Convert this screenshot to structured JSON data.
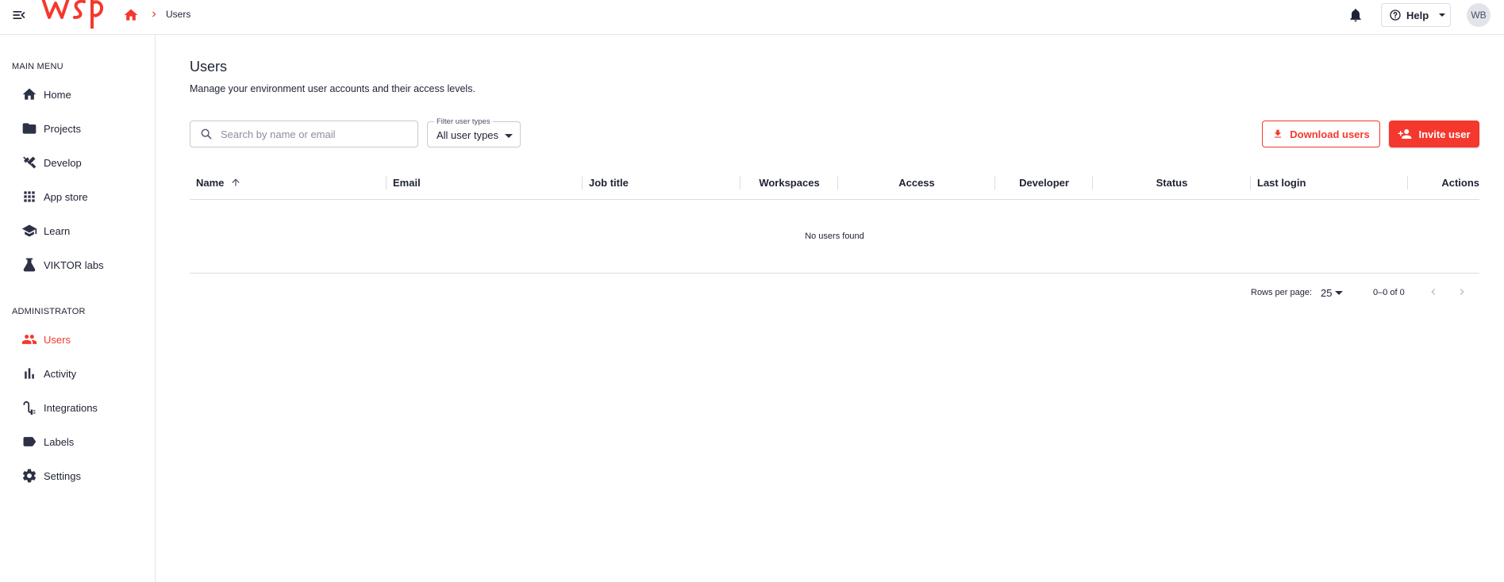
{
  "colors": {
    "accent": "#f5382d",
    "text": "#1e2235",
    "border": "#dcdde3"
  },
  "header": {
    "breadcrumb_current": "Users",
    "help_label": "Help",
    "avatar_initials": "WB",
    "icons": [
      "menu-collapse-icon",
      "logo",
      "home-icon",
      "chevron-right-icon",
      "bell-icon",
      "help-circle-icon",
      "caret-down-icon"
    ]
  },
  "sidebar": {
    "main_menu_label": "MAIN MENU",
    "main_items": [
      {
        "label": "Home",
        "icon": "home-icon"
      },
      {
        "label": "Projects",
        "icon": "folder-icon"
      },
      {
        "label": "Develop",
        "icon": "tools-icon"
      },
      {
        "label": "App store",
        "icon": "grid-icon"
      },
      {
        "label": "Learn",
        "icon": "school-icon"
      },
      {
        "label": "VIKTOR labs",
        "icon": "flask-icon"
      }
    ],
    "admin_label": "ADMINISTRATOR",
    "admin_items": [
      {
        "label": "Users",
        "icon": "people-icon",
        "active": true
      },
      {
        "label": "Activity",
        "icon": "bar-chart-icon"
      },
      {
        "label": "Integrations",
        "icon": "integration-icon"
      },
      {
        "label": "Labels",
        "icon": "label-icon"
      },
      {
        "label": "Settings",
        "icon": "gear-icon"
      }
    ]
  },
  "main": {
    "title": "Users",
    "subtitle": "Manage your environment user accounts and their access levels.",
    "search_placeholder": "Search by name or email",
    "filter": {
      "label": "Filter user types",
      "value": "All user types"
    },
    "download_label": "Download users",
    "invite_label": "Invite user",
    "table": {
      "columns": [
        "Name",
        "Email",
        "Job title",
        "Workspaces",
        "Access",
        "Developer",
        "Status",
        "Last login",
        "Actions"
      ],
      "sorted_column": "Name",
      "sort_direction": "ascending",
      "empty_text": "No users found"
    },
    "pagination": {
      "rows_label": "Rows per page:",
      "rows_value": "25",
      "range": "0–0 of 0"
    }
  }
}
